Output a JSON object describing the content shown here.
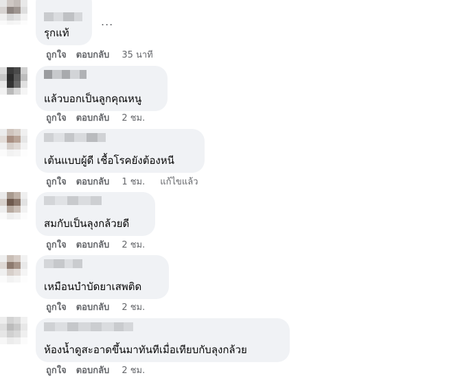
{
  "comments": [
    {
      "text": "รุกแท้",
      "like": "ถูกใจ",
      "reply": "ตอบกลับ",
      "time": "35 นาที",
      "edited": ""
    },
    {
      "text": "แล้วบอกเป็นลูกคุณหนู",
      "like": "ถูกใจ",
      "reply": "ตอบกลับ",
      "time": "2 ชม.",
      "edited": ""
    },
    {
      "text": "เต้นแบบผู้ดี เชื้อโรคยังต้องหนี",
      "like": "ถูกใจ",
      "reply": "ตอบกลับ",
      "time": "1 ชม.",
      "edited": "แก้ไขแล้ว"
    },
    {
      "text": "สมกับเป็นลุงกล้วยดี",
      "like": "ถูกใจ",
      "reply": "ตอบกลับ",
      "time": "2 ชม.",
      "edited": ""
    },
    {
      "text": "เหมือนบำบัดยาเสพติด",
      "like": "ถูกใจ",
      "reply": "ตอบกลับ",
      "time": "2 ชม.",
      "edited": ""
    },
    {
      "text": "ห้องน้ำดูสะอาดขึ้นมาทันทีเมื่อเทียบกับลุงกล้วย",
      "like": "ถูกใจ",
      "reply": "ตอบกลับ",
      "time": "2 ชม.",
      "edited": ""
    }
  ],
  "more_options": "...",
  "icons": {
    "more": "more-options-icon"
  }
}
